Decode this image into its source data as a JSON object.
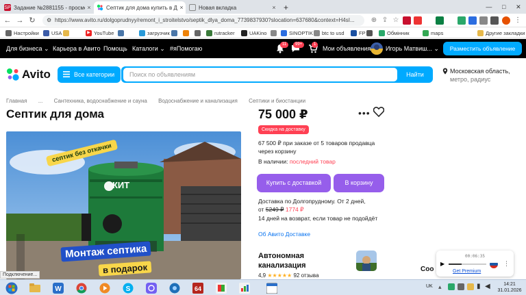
{
  "browser": {
    "tabs": [
      {
        "favicon": "SP",
        "title": "Задание №2881155 - просмотр з"
      },
      {
        "favicon": "avito",
        "title": "Септик для дома купить в Долго"
      },
      {
        "favicon": "page",
        "title": "Новая вкладка"
      },
      {
        "favicon": "new-tab",
        "title": "+"
      }
    ],
    "url": "https://www.avito.ru/dolgoprudnyy/remont_i_stroitelstvo/septik_dlya_doma_7739837930?slocation=637680&context=H4sI...",
    "extensions": [
      {
        "label": "11",
        "color": "#2b6de0"
      },
      {
        "label": "LTC",
        "color": "#4a5a7a"
      },
      {
        "label": "+",
        "color": "#3a8f3a"
      }
    ],
    "bookmarks": [
      {
        "icon": "gear-icon",
        "label": "Настройки",
        "color": "#555"
      },
      {
        "icon": "flag-icon",
        "label": "USA",
        "color": "#3c5ca8"
      },
      {
        "icon": "folder-icon",
        "label": "",
        "color": "#e6b84a"
      },
      {
        "icon": "youtube-icon",
        "label": "YouTube",
        "color": "#e22"
      },
      {
        "icon": "vk-icon",
        "label": "",
        "color": "#4a76a8"
      },
      {
        "icon": "download-icon",
        "label": "загрузчик",
        "color": "#2a9ad8"
      },
      {
        "icon": "vk-icon",
        "label": "",
        "color": "#4a76a8"
      },
      {
        "icon": "ok-icon",
        "label": "",
        "color": "#ee8208"
      },
      {
        "icon": "pin-icon",
        "label": "",
        "color": "#666"
      },
      {
        "icon": "rutracker-icon",
        "label": "rutracker",
        "color": "#3a7a3a"
      },
      {
        "icon": "uakino-icon",
        "label": "UAKino",
        "color": "#222"
      },
      {
        "icon": "page-icon",
        "label": "",
        "color": "#888"
      },
      {
        "icon": "sinoptik-icon",
        "label": "SINOPTIK",
        "color": "#2b6de0"
      },
      {
        "icon": "page-icon",
        "label": "btc to usd",
        "color": "#888"
      },
      {
        "icon": "fp-icon",
        "label": "FP",
        "color": "#1a4fa0"
      },
      {
        "icon": "app-icon",
        "label": "",
        "color": "#555"
      },
      {
        "icon": "exchange-icon",
        "label": "Обмінник",
        "color": "#2aa86a"
      },
      {
        "icon": "maps-icon",
        "label": "maps",
        "color": "#34a853"
      },
      {
        "icon": "folder-icon",
        "label": "Другие закладки",
        "color": "#e6b84a"
      }
    ]
  },
  "avito": {
    "topnav": {
      "business": "Для бизнеса",
      "career": "Карьера в Авито",
      "help": "Помощь",
      "catalogs": "Каталоги",
      "ya_pomogayu": "#яПомогаю",
      "notif_badge": "11",
      "messages_badge": "99+",
      "cart_badge": "1",
      "my_ads": "Мои объявления",
      "user_name": "Игорь Матвиш...",
      "post_ad": "Разместить объявление"
    },
    "logo_text": "Avito",
    "categories_button": "Все категории",
    "search_placeholder": "Поиск по объявлениям",
    "find_button": "Найти",
    "location_line1": "Московская область,",
    "location_line2": "метро, радиус",
    "breadcrumbs": [
      "Главная",
      "...",
      "Сантехника, водоснабжение и сауна",
      "Водоснабжение и канализация",
      "Септики и биостанции"
    ],
    "title": "Септик для дома",
    "price": "75 000 ₽",
    "discount_badge": "Скидка на доставку",
    "bulk_price_line1": "67 500 ₽ при заказе от 5 товаров продавца",
    "bulk_price_line2": "через корзину",
    "stock_label": "В наличии:",
    "stock_value": "последний товар",
    "buy_delivery_button": "Купить с доставкой",
    "to_cart_button": "В корзину",
    "delivery_line1": "Доставка по Долгопрудному. От 2 дней,",
    "delivery_from": "от",
    "delivery_old_price": "5249 ₽",
    "delivery_new_price": "1774 ₽",
    "return_line": "14 дней на возврат, если товар не подойдёт",
    "avito_delivery_link": "Об Авито Доставке",
    "seller_line1": "Автономная",
    "seller_line2": "канализация",
    "rating_value": "4,9",
    "rating_stars": 5,
    "reviews": "92 отзыва",
    "photo_badge_text": "септик без откачки",
    "photo_brand": "КИТ",
    "photo_caption": "Монтаж септика",
    "photo_caption2": "в подарок"
  },
  "statusbar_text": "Подключение...",
  "recorder": {
    "time": "00:06:35",
    "premium_link": "Get Premium"
  },
  "coo_text": "Coo",
  "system_tray": {
    "lang": "UK",
    "time": "14:21",
    "date": "31.01.2026"
  },
  "colors": {
    "avito_blue": "#00aaff",
    "avito_purple": "#965eeb",
    "avito_red": "#ff4053",
    "link": "#0a74f0"
  }
}
